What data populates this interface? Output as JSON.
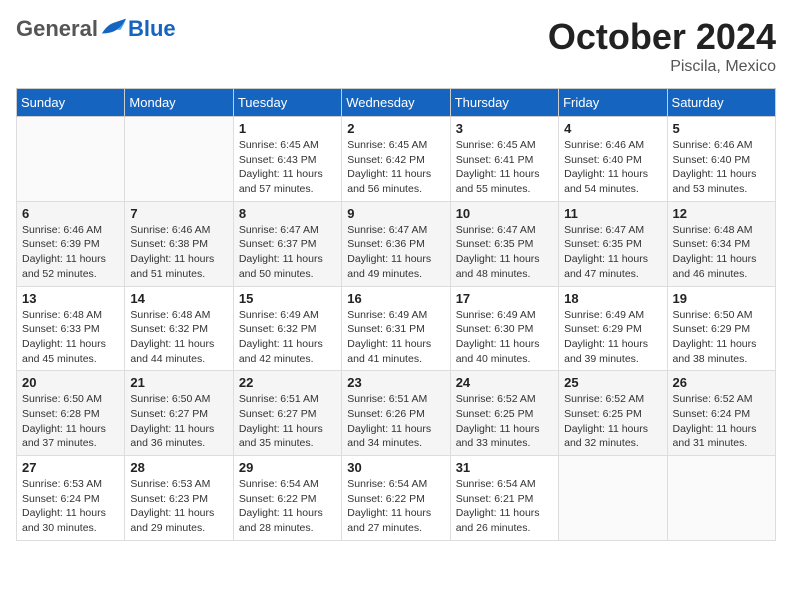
{
  "header": {
    "logo_general": "General",
    "logo_blue": "Blue",
    "month": "October 2024",
    "location": "Piscila, Mexico"
  },
  "days_of_week": [
    "Sunday",
    "Monday",
    "Tuesday",
    "Wednesday",
    "Thursday",
    "Friday",
    "Saturday"
  ],
  "weeks": [
    [
      {
        "day": "",
        "info": ""
      },
      {
        "day": "",
        "info": ""
      },
      {
        "day": "1",
        "info": "Sunrise: 6:45 AM\nSunset: 6:43 PM\nDaylight: 11 hours and 57 minutes."
      },
      {
        "day": "2",
        "info": "Sunrise: 6:45 AM\nSunset: 6:42 PM\nDaylight: 11 hours and 56 minutes."
      },
      {
        "day": "3",
        "info": "Sunrise: 6:45 AM\nSunset: 6:41 PM\nDaylight: 11 hours and 55 minutes."
      },
      {
        "day": "4",
        "info": "Sunrise: 6:46 AM\nSunset: 6:40 PM\nDaylight: 11 hours and 54 minutes."
      },
      {
        "day": "5",
        "info": "Sunrise: 6:46 AM\nSunset: 6:40 PM\nDaylight: 11 hours and 53 minutes."
      }
    ],
    [
      {
        "day": "6",
        "info": "Sunrise: 6:46 AM\nSunset: 6:39 PM\nDaylight: 11 hours and 52 minutes."
      },
      {
        "day": "7",
        "info": "Sunrise: 6:46 AM\nSunset: 6:38 PM\nDaylight: 11 hours and 51 minutes."
      },
      {
        "day": "8",
        "info": "Sunrise: 6:47 AM\nSunset: 6:37 PM\nDaylight: 11 hours and 50 minutes."
      },
      {
        "day": "9",
        "info": "Sunrise: 6:47 AM\nSunset: 6:36 PM\nDaylight: 11 hours and 49 minutes."
      },
      {
        "day": "10",
        "info": "Sunrise: 6:47 AM\nSunset: 6:35 PM\nDaylight: 11 hours and 48 minutes."
      },
      {
        "day": "11",
        "info": "Sunrise: 6:47 AM\nSunset: 6:35 PM\nDaylight: 11 hours and 47 minutes."
      },
      {
        "day": "12",
        "info": "Sunrise: 6:48 AM\nSunset: 6:34 PM\nDaylight: 11 hours and 46 minutes."
      }
    ],
    [
      {
        "day": "13",
        "info": "Sunrise: 6:48 AM\nSunset: 6:33 PM\nDaylight: 11 hours and 45 minutes."
      },
      {
        "day": "14",
        "info": "Sunrise: 6:48 AM\nSunset: 6:32 PM\nDaylight: 11 hours and 44 minutes."
      },
      {
        "day": "15",
        "info": "Sunrise: 6:49 AM\nSunset: 6:32 PM\nDaylight: 11 hours and 42 minutes."
      },
      {
        "day": "16",
        "info": "Sunrise: 6:49 AM\nSunset: 6:31 PM\nDaylight: 11 hours and 41 minutes."
      },
      {
        "day": "17",
        "info": "Sunrise: 6:49 AM\nSunset: 6:30 PM\nDaylight: 11 hours and 40 minutes."
      },
      {
        "day": "18",
        "info": "Sunrise: 6:49 AM\nSunset: 6:29 PM\nDaylight: 11 hours and 39 minutes."
      },
      {
        "day": "19",
        "info": "Sunrise: 6:50 AM\nSunset: 6:29 PM\nDaylight: 11 hours and 38 minutes."
      }
    ],
    [
      {
        "day": "20",
        "info": "Sunrise: 6:50 AM\nSunset: 6:28 PM\nDaylight: 11 hours and 37 minutes."
      },
      {
        "day": "21",
        "info": "Sunrise: 6:50 AM\nSunset: 6:27 PM\nDaylight: 11 hours and 36 minutes."
      },
      {
        "day": "22",
        "info": "Sunrise: 6:51 AM\nSunset: 6:27 PM\nDaylight: 11 hours and 35 minutes."
      },
      {
        "day": "23",
        "info": "Sunrise: 6:51 AM\nSunset: 6:26 PM\nDaylight: 11 hours and 34 minutes."
      },
      {
        "day": "24",
        "info": "Sunrise: 6:52 AM\nSunset: 6:25 PM\nDaylight: 11 hours and 33 minutes."
      },
      {
        "day": "25",
        "info": "Sunrise: 6:52 AM\nSunset: 6:25 PM\nDaylight: 11 hours and 32 minutes."
      },
      {
        "day": "26",
        "info": "Sunrise: 6:52 AM\nSunset: 6:24 PM\nDaylight: 11 hours and 31 minutes."
      }
    ],
    [
      {
        "day": "27",
        "info": "Sunrise: 6:53 AM\nSunset: 6:24 PM\nDaylight: 11 hours and 30 minutes."
      },
      {
        "day": "28",
        "info": "Sunrise: 6:53 AM\nSunset: 6:23 PM\nDaylight: 11 hours and 29 minutes."
      },
      {
        "day": "29",
        "info": "Sunrise: 6:54 AM\nSunset: 6:22 PM\nDaylight: 11 hours and 28 minutes."
      },
      {
        "day": "30",
        "info": "Sunrise: 6:54 AM\nSunset: 6:22 PM\nDaylight: 11 hours and 27 minutes."
      },
      {
        "day": "31",
        "info": "Sunrise: 6:54 AM\nSunset: 6:21 PM\nDaylight: 11 hours and 26 minutes."
      },
      {
        "day": "",
        "info": ""
      },
      {
        "day": "",
        "info": ""
      }
    ]
  ]
}
